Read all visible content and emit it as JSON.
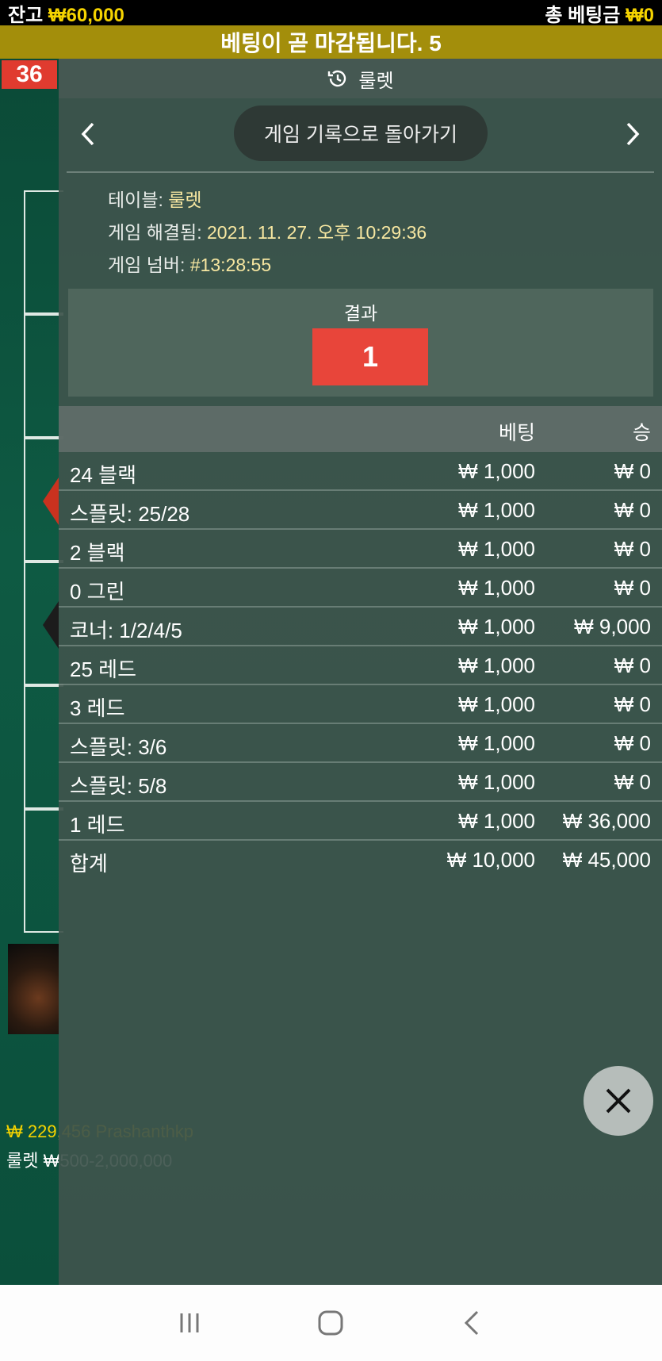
{
  "status": {
    "balance_label": "잔고",
    "balance_value": "₩60,000",
    "total_bet_label": "총 베팅금",
    "total_bet_value": "₩0"
  },
  "closing_message": "베팅이 곧 마감됩니다. 5",
  "background": {
    "last_number": "36",
    "bottom_amount": "₩ 229,456 Prashanthkp",
    "bottom_table": "룰렛 ₩500-2,000,000"
  },
  "panel": {
    "header_title": "룰렛",
    "back_button": "게임 기록으로 돌아가기",
    "info": [
      {
        "label": "테이블:",
        "value": "룰렛"
      },
      {
        "label": "게임 해결됨:",
        "value": "2021. 11. 27. 오후 10:29:36"
      },
      {
        "label": "게임 넘버:",
        "value": "#13:28:55"
      }
    ],
    "result_label": "결과",
    "result_number": "1",
    "result_color": "#e8453a",
    "table": {
      "headers": {
        "bet": "베팅",
        "win": "승"
      },
      "rows": [
        {
          "name": "24 블랙",
          "bet": "₩ 1,000",
          "win": "₩ 0"
        },
        {
          "name": "스플릿: 25/28",
          "bet": "₩ 1,000",
          "win": "₩ 0"
        },
        {
          "name": "2 블랙",
          "bet": "₩ 1,000",
          "win": "₩ 0"
        },
        {
          "name": "0 그린",
          "bet": "₩ 1,000",
          "win": "₩ 0"
        },
        {
          "name": "코너: 1/2/4/5",
          "bet": "₩ 1,000",
          "win": "₩ 9,000"
        },
        {
          "name": "25 레드",
          "bet": "₩ 1,000",
          "win": "₩ 0"
        },
        {
          "name": "3 레드",
          "bet": "₩ 1,000",
          "win": "₩ 0"
        },
        {
          "name": "스플릿: 3/6",
          "bet": "₩ 1,000",
          "win": "₩ 0"
        },
        {
          "name": "스플릿: 5/8",
          "bet": "₩ 1,000",
          "win": "₩ 0"
        },
        {
          "name": "1 레드",
          "bet": "₩ 1,000",
          "win": "₩ 36,000"
        }
      ],
      "total": {
        "name": "합계",
        "bet": "₩ 10,000",
        "win": "₩ 45,000"
      }
    }
  },
  "icons": {
    "history": "history-icon",
    "prev": "chevron-left-icon",
    "next": "chevron-right-icon",
    "close": "close-icon"
  }
}
